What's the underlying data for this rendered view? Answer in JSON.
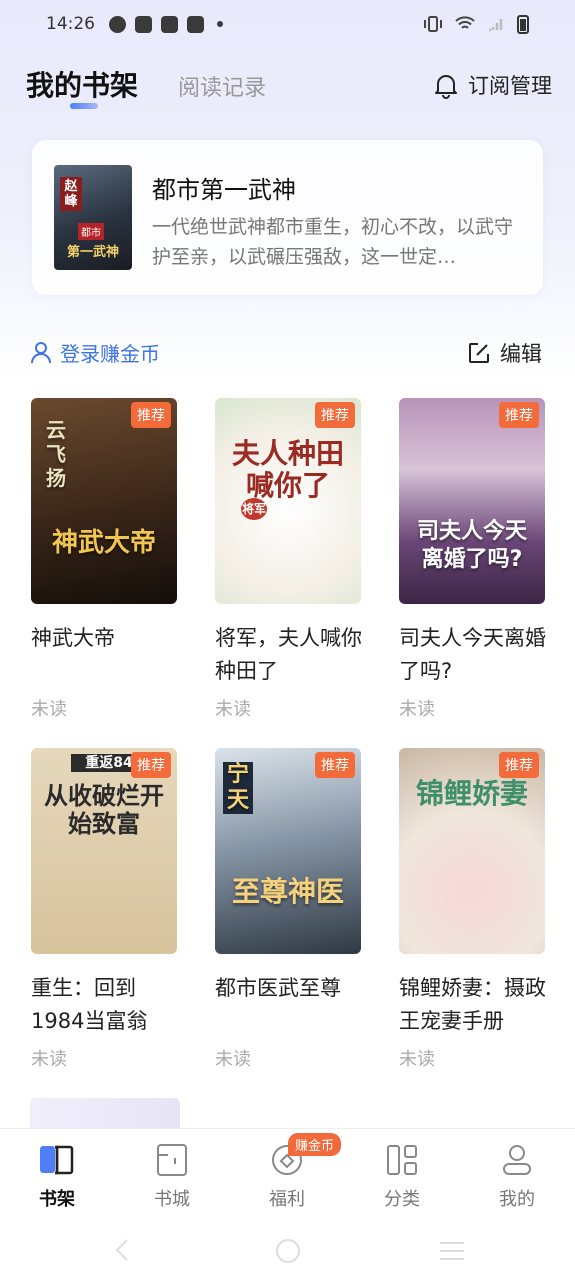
{
  "status_bar": {
    "time": "14:26"
  },
  "header": {
    "tab_shelf": "我的书架",
    "tab_history": "阅读记录",
    "subscribe_label": "订阅管理"
  },
  "featured": {
    "title": "都市第一武神",
    "description": "一代绝世武神都市重生，初心不改，以武守护至亲，以武碾压强敌，这一世定…",
    "cover_text_top": "赵峰",
    "cover_text_bottom": "第一武神",
    "cover_text_mid": "都市"
  },
  "actions": {
    "login_label": "登录赚金币",
    "edit_label": "编辑"
  },
  "books": [
    {
      "title": "神武大帝",
      "status": "未读",
      "tag": "推荐",
      "cover_text": "神武大帝",
      "cover_sub": "云飞扬",
      "colors": [
        "#5b3a24",
        "#1f1611"
      ]
    },
    {
      "title": "将军，夫人喊你种田了",
      "status": "未读",
      "tag": "推荐",
      "cover_text": "夫人种田喊你了",
      "cover_sub": "将军",
      "colors": [
        "#f6f3ee",
        "#e3ecd9"
      ]
    },
    {
      "title": "司夫人今天离婚了吗?",
      "status": "未读",
      "tag": "推荐",
      "cover_text": "司夫人今天离婚了吗?",
      "cover_sub": "",
      "colors": [
        "#c7a8c8",
        "#6d4a7a"
      ]
    },
    {
      "title": "重生：回到1984当富翁",
      "status": "未读",
      "tag": "推荐",
      "cover_text": "从收破烂开始致富",
      "cover_sub": "重返84",
      "colors": [
        "#e5d6bb",
        "#c9b690"
      ]
    },
    {
      "title": "都市医武至尊",
      "status": "未读",
      "tag": "推荐",
      "cover_text": "至尊神医",
      "cover_sub": "宁天",
      "colors": [
        "#c6d2de",
        "#3b4654"
      ]
    },
    {
      "title": "锦鲤娇妻：摄政王宠妻手册",
      "status": "未读",
      "tag": "推荐",
      "cover_text": "锦鲤娇妻",
      "cover_sub": "",
      "colors": [
        "#f3efe9",
        "#d7c6b6"
      ]
    }
  ],
  "bottom_nav": {
    "items": [
      {
        "label": "书架"
      },
      {
        "label": "书城"
      },
      {
        "label": "福利"
      },
      {
        "label": "分类"
      },
      {
        "label": "我的"
      }
    ],
    "earn_badge": "赚金币"
  }
}
